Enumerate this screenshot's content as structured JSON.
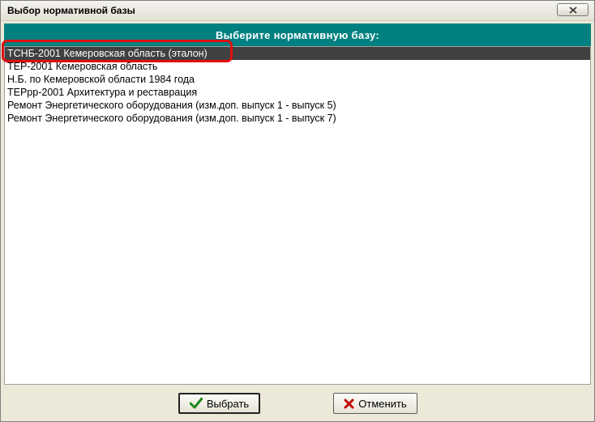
{
  "window": {
    "title": "Выбор нормативной базы"
  },
  "heading": "Выберите нормативную базу:",
  "list": {
    "items": [
      {
        "label": "ТСНБ-2001 Кемеровская область (эталон)",
        "selected": true
      },
      {
        "label": "ТЕР-2001 Кемеровская область"
      },
      {
        "label": "Н.Б. по Кемеровской области 1984 года"
      },
      {
        "label": "ТЕРрр-2001 Архитектура и реставрация"
      },
      {
        "label": "Ремонт Энергетического оборудования (изм.доп. выпуск 1 - выпуск 5)"
      },
      {
        "label": "Ремонт Энергетического оборудования (изм.доп. выпуск 1 - выпуск 7)"
      }
    ]
  },
  "buttons": {
    "ok_label": "Выбрать",
    "ok_icon": "checkmark-icon",
    "cancel_label": "Отменить",
    "cancel_icon": "x-mark-icon"
  },
  "colors": {
    "heading_bg": "#008080",
    "selection_bg": "#404040",
    "annotation": "#e01010"
  }
}
